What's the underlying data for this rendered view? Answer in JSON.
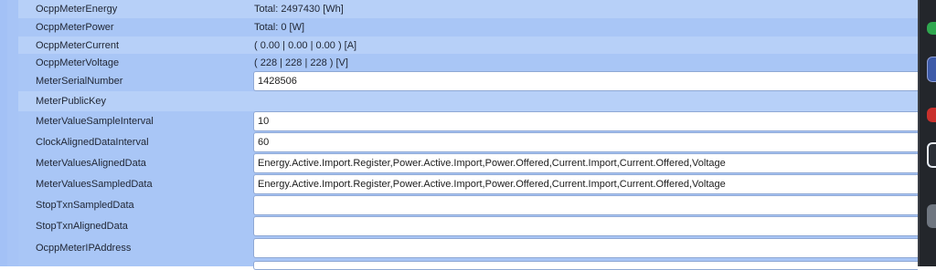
{
  "rows": [
    {
      "label": "OcppMeterEnergy",
      "value": "Total: 2497430 [Wh]"
    },
    {
      "label": "OcppMeterPower",
      "value": "Total: 0 [W]"
    },
    {
      "label": "OcppMeterCurrent",
      "value": "( 0.00 | 0.00 | 0.00 ) [A]"
    },
    {
      "label": "OcppMeterVoltage",
      "value": "( 228 | 228 | 228 ) [V]"
    },
    {
      "label": "MeterSerialNumber",
      "value": "1428506"
    },
    {
      "label": "MeterPublicKey",
      "value": ""
    },
    {
      "label": "MeterValueSampleInterval",
      "value": "10"
    },
    {
      "label": "ClockAlignedDataInterval",
      "value": "60"
    },
    {
      "label": "MeterValuesAlignedData",
      "value": "Energy.Active.Import.Register,Power.Active.Import,Power.Offered,Current.Import,Current.Offered,Voltage"
    },
    {
      "label": "MeterValuesSampledData",
      "value": "Energy.Active.Import.Register,Power.Active.Import,Power.Offered,Current.Import,Current.Offered,Voltage"
    },
    {
      "label": "StopTxnSampledData",
      "value": ""
    },
    {
      "label": "StopTxnAlignedData",
      "value": ""
    },
    {
      "label": "OcppMeterIPAddress",
      "value": ""
    }
  ],
  "colors": {
    "page_background": "#a9c6f6",
    "row_alt": "#b7d0f8",
    "field_background": "#ffffff",
    "taskbar": "#23262b"
  },
  "icons": [
    "app-icon-green",
    "app-icon-blue",
    "app-icon-red",
    "shield-icon",
    "app-icon-grey"
  ]
}
